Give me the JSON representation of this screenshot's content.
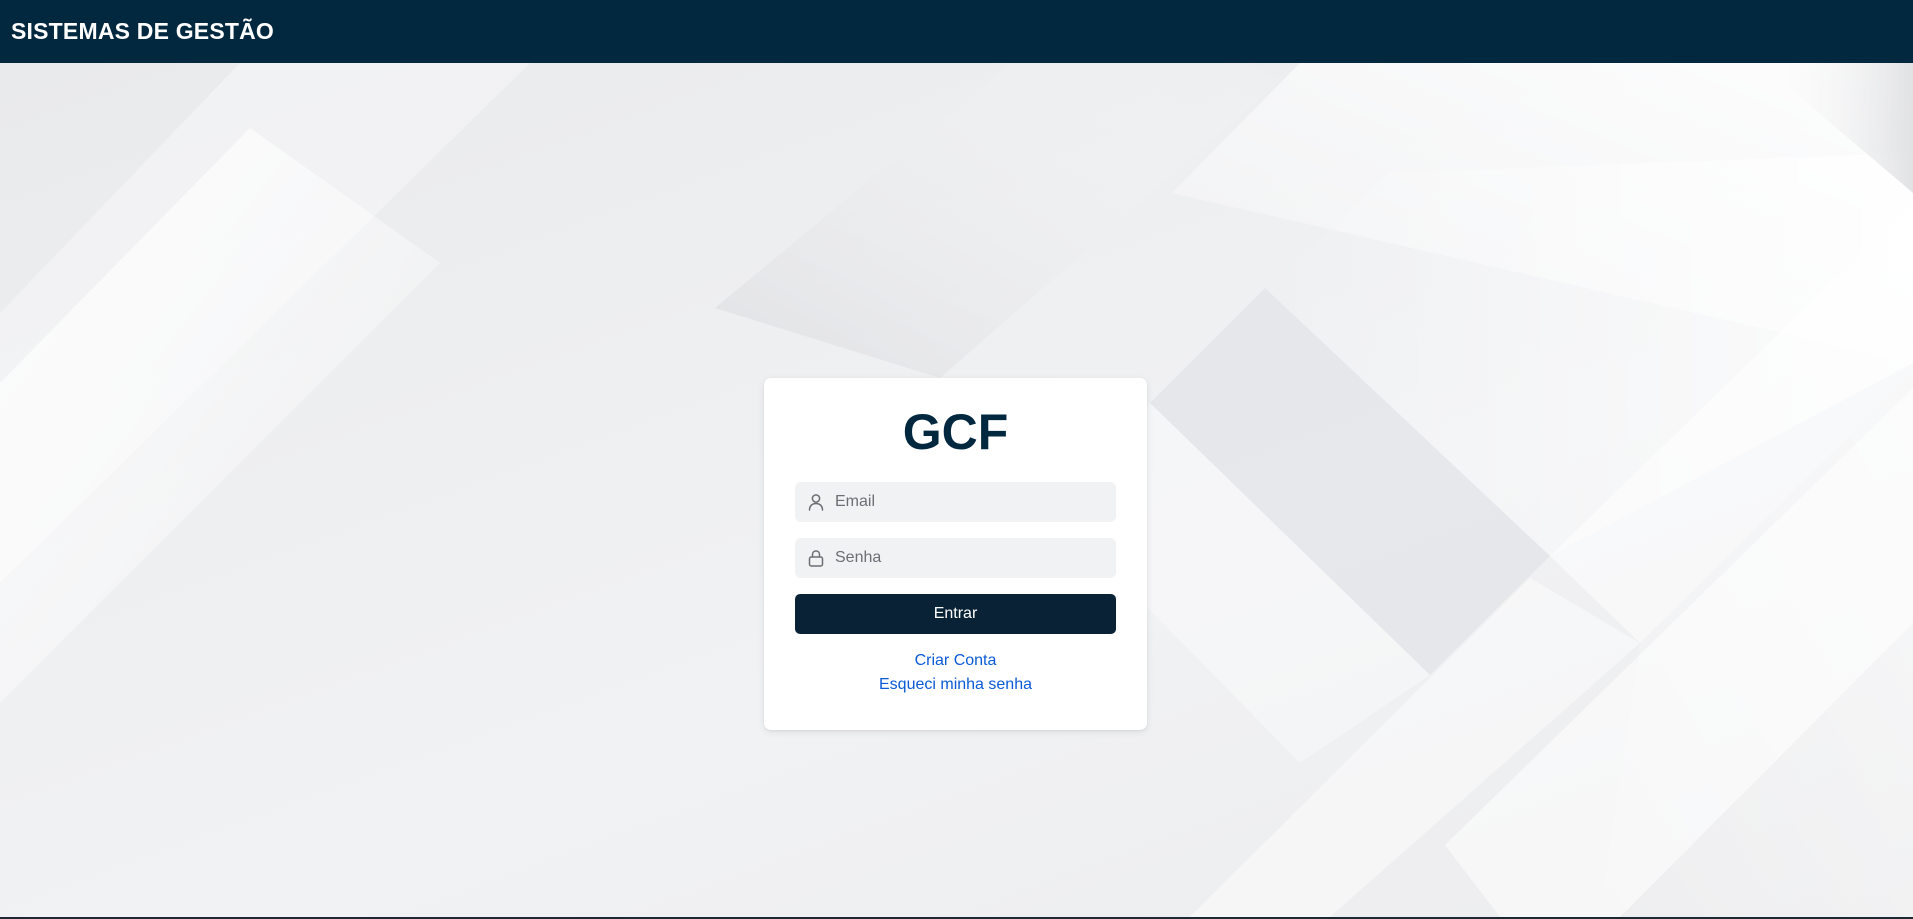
{
  "header": {
    "title": "SISTEMAS DE GESTÃO"
  },
  "login": {
    "brand": "GCF",
    "email": {
      "placeholder": "Email",
      "value": "",
      "icon": "user-icon"
    },
    "password": {
      "placeholder": "Senha",
      "value": "",
      "icon": "lock-icon"
    },
    "submit_label": "Entrar",
    "create_account_label": "Criar Conta",
    "forgot_password_label": "Esqueci minha senha"
  },
  "colors": {
    "header_bg": "#022840",
    "brand_text": "#022840",
    "button_bg": "#0a2236",
    "link": "#0b5ad6",
    "input_bg": "#f1f2f4"
  }
}
